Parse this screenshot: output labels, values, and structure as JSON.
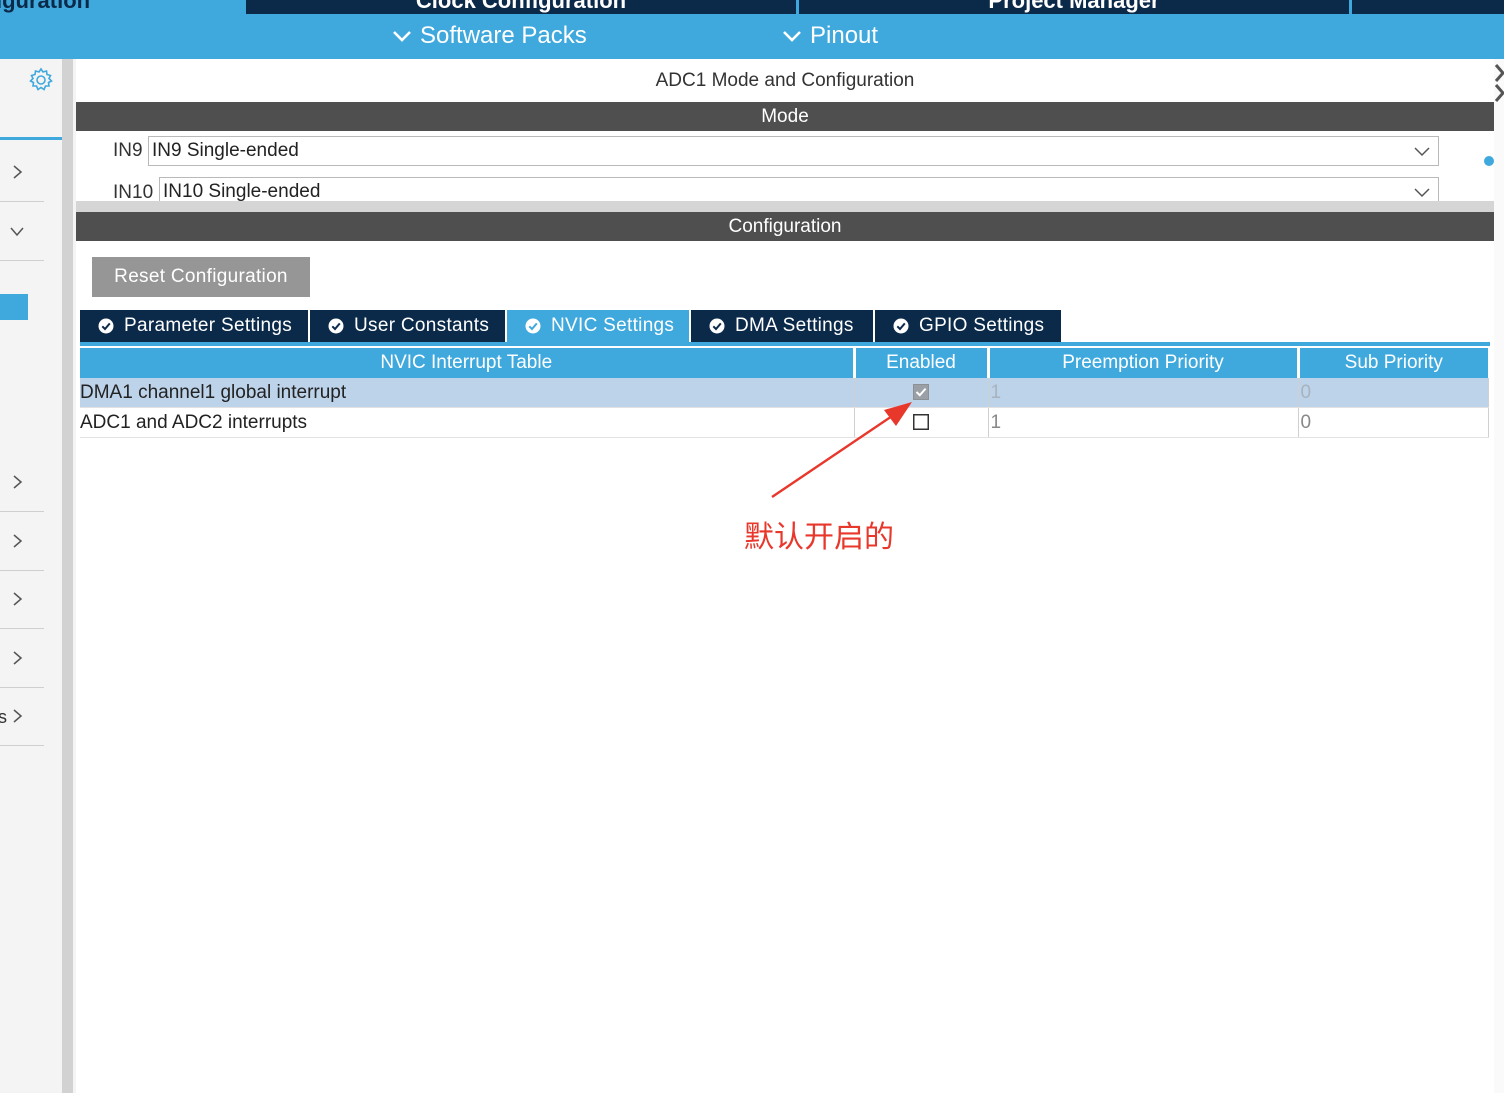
{
  "top_tabs": [
    "iguration",
    "Clock Configuration",
    "Project Manager"
  ],
  "sub_header": {
    "software_packs": "Software Packs",
    "pinout": "Pinout"
  },
  "sidebar": {
    "cut_label": "s"
  },
  "panel": {
    "title": "ADC1 Mode and Configuration",
    "mode_label": "Mode",
    "mode_rows": [
      {
        "label": "IN9",
        "value": "IN9 Single-ended"
      },
      {
        "label": "IN10",
        "value": "IN10 Single-ended"
      }
    ],
    "config_label": "Configuration",
    "reset_button": "Reset Configuration",
    "tabs": [
      "Parameter Settings",
      "User Constants",
      "NVIC Settings",
      "DMA Settings",
      "GPIO Settings"
    ],
    "active_tab": "NVIC Settings"
  },
  "nvic_table": {
    "headers": [
      "NVIC Interrupt Table",
      "Enabled",
      "Preemption Priority",
      "Sub Priority"
    ],
    "rows": [
      {
        "name": "DMA1 channel1 global interrupt",
        "enabled": true,
        "preemption": "1",
        "sub": "0"
      },
      {
        "name": "ADC1 and ADC2 interrupts",
        "enabled": false,
        "preemption": "1",
        "sub": "0"
      }
    ]
  },
  "annotation": {
    "text": "默认开启的",
    "color": "#e8372b"
  },
  "colors": {
    "accent": "#3fa9dd",
    "dark_navy": "#0b2a4a",
    "section_bar": "#4f4f4f"
  }
}
